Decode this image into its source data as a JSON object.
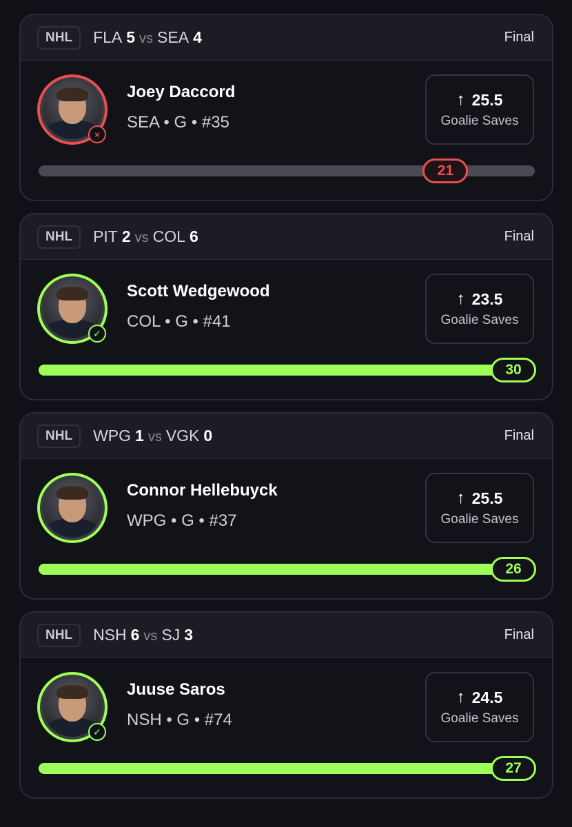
{
  "colors": {
    "hit": "#9dff57",
    "miss": "#ea4f4f",
    "card_bg": "#121219",
    "header_bg": "#1c1c24"
  },
  "cards": [
    {
      "league": "NHL",
      "away_team": "FLA",
      "away_score": "5",
      "vs": "vs",
      "home_team": "SEA",
      "home_score": "4",
      "status": "Final",
      "player_name": "Joey Daccord",
      "player_info": "SEA • G • #35",
      "line": "25.5",
      "stat_label": "Goalie Saves",
      "direction_icon": "arrow-up-icon",
      "result": "21",
      "progress": 0.82,
      "outcome": "miss",
      "status_icon": "x-icon",
      "status_glyph": "×"
    },
    {
      "league": "NHL",
      "away_team": "PIT",
      "away_score": "2",
      "vs": "vs",
      "home_team": "COL",
      "home_score": "6",
      "status": "Final",
      "player_name": "Scott Wedgewood",
      "player_info": "COL • G • #41",
      "line": "23.5",
      "stat_label": "Goalie Saves",
      "direction_icon": "arrow-up-icon",
      "result": "30",
      "progress": 1.0,
      "outcome": "hit",
      "status_icon": "check-icon",
      "status_glyph": "✓"
    },
    {
      "league": "NHL",
      "away_team": "WPG",
      "away_score": "1",
      "vs": "vs",
      "home_team": "VGK",
      "home_score": "0",
      "status": "Final",
      "player_name": "Connor Hellebuyck",
      "player_info": "WPG • G • #37",
      "line": "25.5",
      "stat_label": "Goalie Saves",
      "direction_icon": "arrow-up-icon",
      "result": "26",
      "progress": 1.0,
      "outcome": "hit",
      "status_icon": "",
      "status_glyph": ""
    },
    {
      "league": "NHL",
      "away_team": "NSH",
      "away_score": "6",
      "vs": "vs",
      "home_team": "SJ",
      "home_score": "3",
      "status": "Final",
      "player_name": "Juuse Saros",
      "player_info": "NSH • G • #74",
      "line": "24.5",
      "stat_label": "Goalie Saves",
      "direction_icon": "arrow-up-icon",
      "result": "27",
      "progress": 1.0,
      "outcome": "hit",
      "status_icon": "check-icon",
      "status_glyph": "✓"
    }
  ]
}
